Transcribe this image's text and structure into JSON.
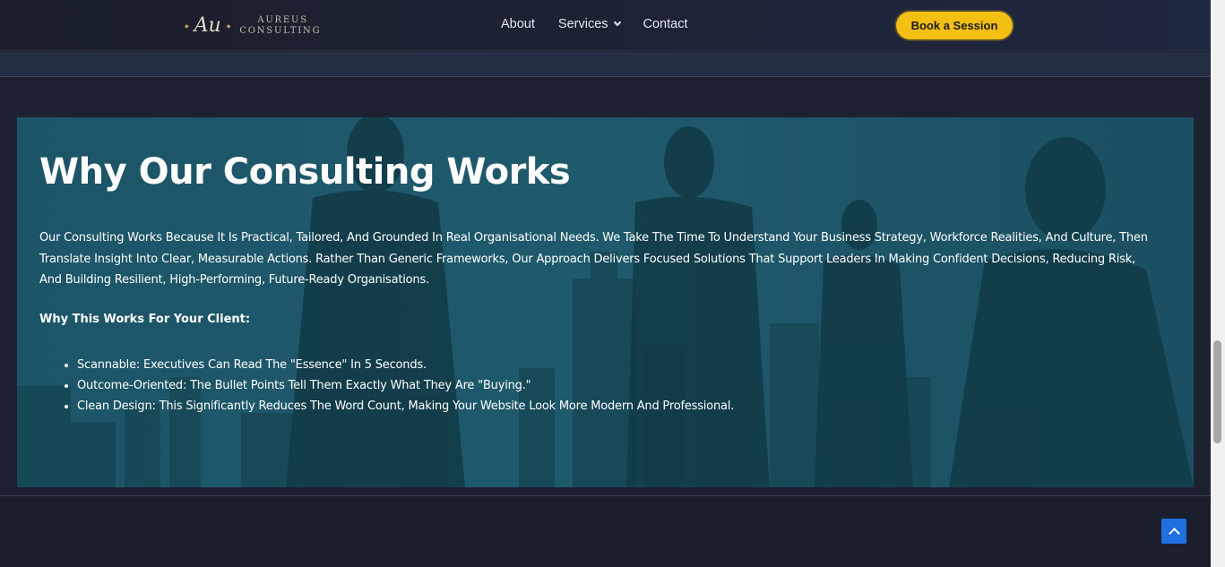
{
  "header": {
    "logo": {
      "monogram": "Au",
      "line1": "AUREUS",
      "line2": "CONSULTING"
    },
    "nav": [
      {
        "label": "About"
      },
      {
        "label": "Services",
        "has_dropdown": true
      },
      {
        "label": "Contact"
      }
    ],
    "cta_label": "Book a Session"
  },
  "hero": {
    "title": "Why Our Consulting Works",
    "paragraph": "Our Consulting Works Because It Is Practical, Tailored, And Grounded In Real Organisational Needs. We Take The Time To Understand Your Business Strategy, Workforce Realities, And Culture, Then Translate Insight Into Clear, Measurable Actions. Rather Than Generic Frameworks, Our Approach Delivers Focused Solutions That Support Leaders In Making Confident Decisions, Reducing Risk, And Building Resilient, High-Performing, Future-Ready Organisations.",
    "subheading": "Why This Works For Your Client:",
    "bullets": [
      "Scannable: Executives Can Read The \"Essence\" In 5 Seconds.",
      "Outcome-Oriented: The Bullet Points Tell Them Exactly What They Are \"Buying.\"",
      "Clean Design: This Significantly Reduces The Word Count, Making Your Website Look More Modern And Professional."
    ]
  },
  "colors": {
    "cta": "#f4bf13",
    "hero_overlay": "#1d5466",
    "scroll_top_button": "#1f6fe0"
  },
  "icons": {
    "services_dropdown": "chevron-down-icon",
    "scroll_top": "arrow-up-icon"
  }
}
